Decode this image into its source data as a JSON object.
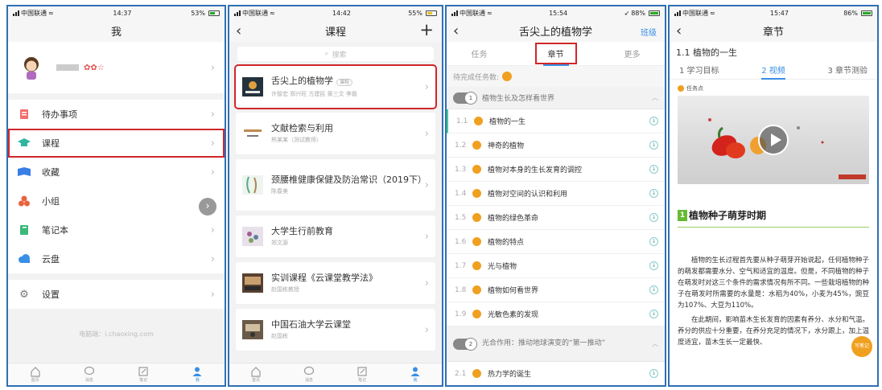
{
  "status": {
    "carrier": "中国联通",
    "p1": {
      "time": "14:37",
      "battery": "53%"
    },
    "p2": {
      "time": "14:42",
      "battery": "55%"
    },
    "p3": {
      "time": "15:54",
      "battery": "88%"
    },
    "p4": {
      "time": "15:47",
      "battery": "86%"
    }
  },
  "me": {
    "title": "我",
    "menu": [
      {
        "label": "待办事项",
        "icon": "todo-icon",
        "color": "#f26d6d"
      },
      {
        "label": "课程",
        "icon": "graduation-cap-icon",
        "color": "#2fb5a0"
      },
      {
        "label": "收藏",
        "icon": "bookmark-icon",
        "color": "#3a7ee6"
      },
      {
        "label": "小组",
        "icon": "group-icon",
        "color": "#e8643c"
      },
      {
        "label": "笔记本",
        "icon": "notebook-icon",
        "color": "#3cb878"
      },
      {
        "label": "云盘",
        "icon": "cloud-icon",
        "color": "#3a8ee6"
      }
    ],
    "settings": "设置",
    "footer": "电脑端：i.chaoxing.com"
  },
  "tabbar": [
    "首页",
    "消息",
    "笔记",
    "我"
  ],
  "courses": {
    "title": "课程",
    "search_placeholder": "搜索",
    "items": [
      {
        "name": "舌尖上的植物学",
        "tag": "课程",
        "teacher": "许智宏 郑兴旺 方建民 黄三文 李磊"
      },
      {
        "name": "文献检索与利用",
        "teacher": "熊某某（测试教师）"
      },
      {
        "name": "颈腰椎健康保健及防治常识（2019下）",
        "teacher": "陈春美"
      },
      {
        "name": "大学生行前教育",
        "teacher": "郑文源"
      },
      {
        "name": "实训课程《云课堂教学法》",
        "teacher": "赵国栋教授"
      },
      {
        "name": "中国石油大学云课堂",
        "teacher": "赵国栋"
      }
    ]
  },
  "course_detail": {
    "title": "舌尖上的植物学",
    "class_label": "班级",
    "tabs": [
      "任务",
      "章节",
      "更多"
    ],
    "pending_label": "待完成任务数:",
    "section1": {
      "num": "1",
      "title": "植物生长及怎样看世界"
    },
    "lessons": [
      {
        "num": "1.1",
        "label": "植物的一生"
      },
      {
        "num": "1.2",
        "label": "神奇的植物"
      },
      {
        "num": "1.3",
        "label": "植物对本身的生长发育的调控"
      },
      {
        "num": "1.4",
        "label": "植物对空间的认识和利用"
      },
      {
        "num": "1.5",
        "label": "植物的绿色革命"
      },
      {
        "num": "1.6",
        "label": "植物的特点"
      },
      {
        "num": "1.7",
        "label": "光与植物"
      },
      {
        "num": "1.8",
        "label": "植物如何看世界"
      },
      {
        "num": "1.9",
        "label": "光敏色素的发现"
      }
    ],
    "section2": {
      "num": "2",
      "title": "光合作用：推动地球演变的“第一推动”"
    },
    "lesson21": {
      "num": "2.1",
      "label": "热力学的诞生"
    }
  },
  "chapter": {
    "title": "章节",
    "heading": "1.1 植物的一生",
    "tabs": [
      "1 学习目标",
      "2 视频",
      "3 章节测验"
    ],
    "task_point": "任务点",
    "section_title": "植物种子萌芽时期",
    "section_num": "1",
    "para1": "植物的生长过程首先要从种子萌芽开始说起，任何植物种子的萌发都需要水分、空气和适宜的温度。但是，不同植物的种子在萌发时对这三个条件的需求情况有所不同。一些栽培植物的种子在萌发时所需要的水量是：水稻为40%，小麦为45%，豌豆为107%、大豆为110%。",
    "para2": "在此期间，影响苗木生长发育的因素有养分、水分和气温。养分的供应十分重要，在养分充足的情况下，水分跟上，加上温度适宜，苗木生长一定最快、",
    "note_btn": "写笔记"
  }
}
